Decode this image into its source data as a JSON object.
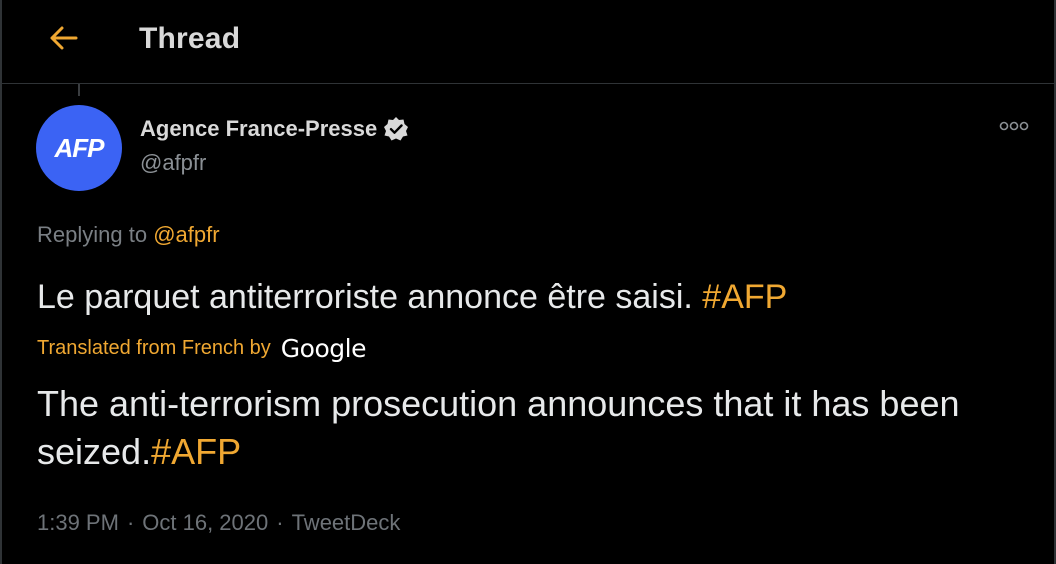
{
  "header": {
    "title": "Thread",
    "back_icon": "arrow-left-icon",
    "accent_color": "#f0a832"
  },
  "tweet": {
    "author": {
      "name": "Agence France-Presse",
      "handle": "@afpfr",
      "avatar_text": "AFP",
      "avatar_color": "#3b63f4",
      "verified": true
    },
    "replying_to_label": "Replying to",
    "replying_to_handle": "@afpfr",
    "text": "Le parquet antiterroriste annonce être saisi. ",
    "text_hashtag": "#AFP",
    "translated_label": "Translated from French by",
    "translator": "Google",
    "translation_text": "The anti-terrorism prosecution announces that it has been seized.",
    "translation_hashtag": "#AFP",
    "time": "1:39 PM",
    "separator": "·",
    "date": "Oct 16, 2020",
    "source": "TweetDeck"
  }
}
